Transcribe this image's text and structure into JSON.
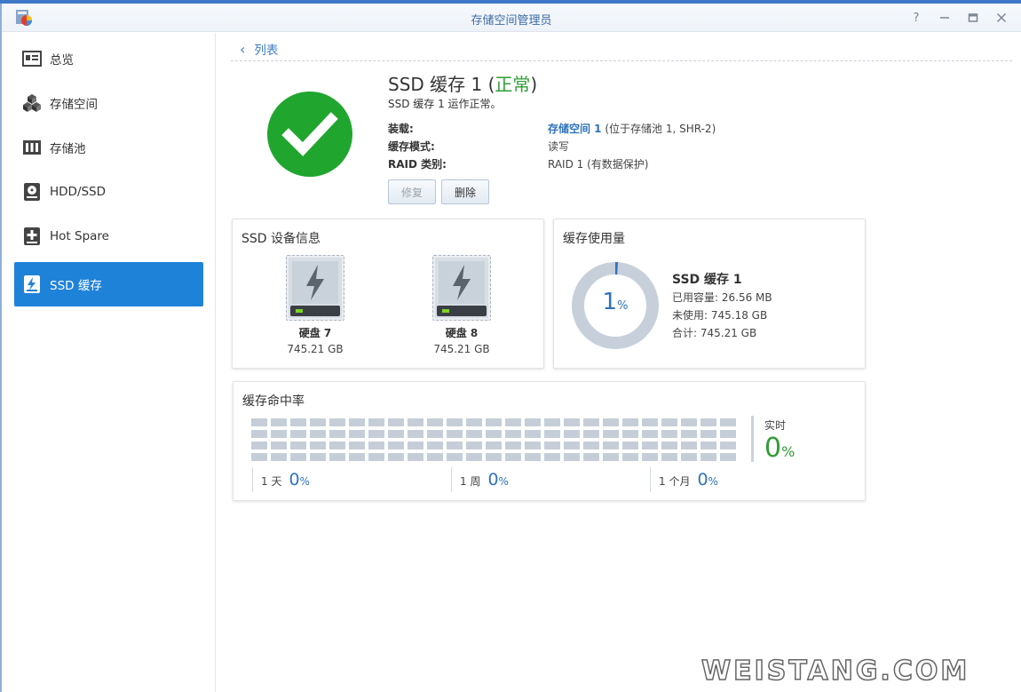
{
  "window": {
    "title": "存储空间管理员"
  },
  "sidebar": {
    "items": [
      {
        "label": "总览",
        "icon": "overview-icon"
      },
      {
        "label": "存储空间",
        "icon": "volume-icon"
      },
      {
        "label": "存储池",
        "icon": "storage-pool-icon"
      },
      {
        "label": "HDD/SSD",
        "icon": "hdd-icon"
      },
      {
        "label": "Hot Spare",
        "icon": "hot-spare-icon"
      },
      {
        "label": "SSD 缓存",
        "icon": "ssd-cache-icon"
      }
    ],
    "active_index": 5
  },
  "main": {
    "back_label": "列表",
    "title_prefix": "SSD 缓存 1 (",
    "title_status": "正常",
    "title_suffix": ")",
    "subtitle": "SSD 缓存 1 运作正常。",
    "details": [
      {
        "label": "装载:",
        "value_link": "存储空间 1",
        "value": " (位于存储池 1, SHR-2)"
      },
      {
        "label": "缓存模式:",
        "value_link": "",
        "value": "读写"
      },
      {
        "label": "RAID 类别:",
        "value_link": "",
        "value": "RAID 1 (有数据保护)"
      }
    ],
    "buttons": {
      "repair": "修复",
      "delete": "删除"
    }
  },
  "ssd_info": {
    "title": "SSD 设备信息",
    "disks": [
      {
        "name": "硬盘 7",
        "size": "745.21 GB"
      },
      {
        "name": "硬盘 8",
        "size": "745.21 GB"
      }
    ]
  },
  "usage": {
    "title": "缓存使用量",
    "percent_value": "1",
    "percent_unit": "%",
    "percent": 1,
    "name": "SSD 缓存 1",
    "used": "已用容量: 26.56 MB",
    "free": "未使用: 745.18 GB",
    "total": "合计: 745.21 GB"
  },
  "hit_rate": {
    "title": "缓存命中率",
    "realtime_label": "实时",
    "realtime_value": "0",
    "realtime_unit": "%",
    "periods": [
      {
        "label": "1 天",
        "value": "0",
        "unit": "%"
      },
      {
        "label": "1 周",
        "value": "0",
        "unit": "%"
      },
      {
        "label": "1 个月",
        "value": "0",
        "unit": "%"
      }
    ]
  },
  "watermark": "WEISTANG.COM",
  "colors": {
    "accent": "#1f82d9",
    "ok_green": "#2e9e35",
    "link_blue": "#2f73bd"
  }
}
